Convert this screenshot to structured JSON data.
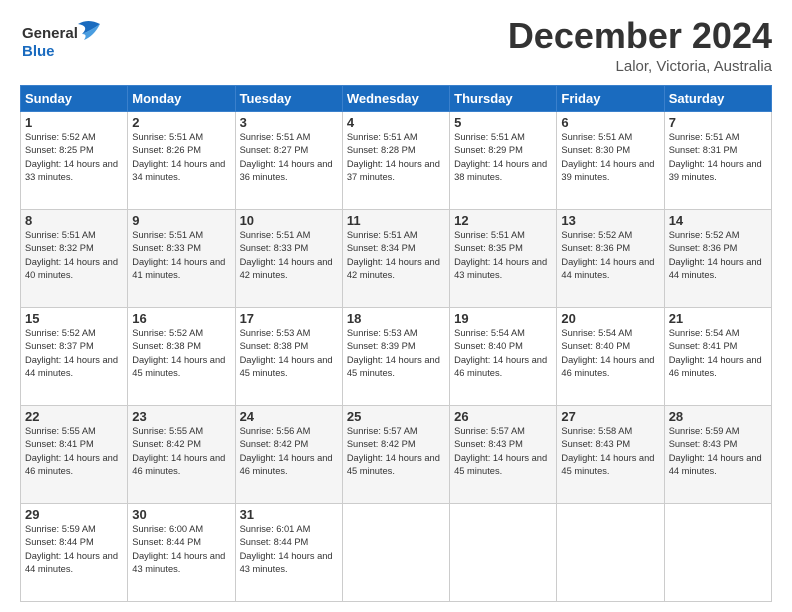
{
  "header": {
    "logo_line1": "General",
    "logo_line2": "Blue",
    "month": "December 2024",
    "location": "Lalor, Victoria, Australia"
  },
  "weekdays": [
    "Sunday",
    "Monday",
    "Tuesday",
    "Wednesday",
    "Thursday",
    "Friday",
    "Saturday"
  ],
  "weeks": [
    [
      {
        "day": "1",
        "sunrise": "5:52 AM",
        "sunset": "8:25 PM",
        "daylight": "14 hours and 33 minutes."
      },
      {
        "day": "2",
        "sunrise": "5:51 AM",
        "sunset": "8:26 PM",
        "daylight": "14 hours and 34 minutes."
      },
      {
        "day": "3",
        "sunrise": "5:51 AM",
        "sunset": "8:27 PM",
        "daylight": "14 hours and 36 minutes."
      },
      {
        "day": "4",
        "sunrise": "5:51 AM",
        "sunset": "8:28 PM",
        "daylight": "14 hours and 37 minutes."
      },
      {
        "day": "5",
        "sunrise": "5:51 AM",
        "sunset": "8:29 PM",
        "daylight": "14 hours and 38 minutes."
      },
      {
        "day": "6",
        "sunrise": "5:51 AM",
        "sunset": "8:30 PM",
        "daylight": "14 hours and 39 minutes."
      },
      {
        "day": "7",
        "sunrise": "5:51 AM",
        "sunset": "8:31 PM",
        "daylight": "14 hours and 39 minutes."
      }
    ],
    [
      {
        "day": "8",
        "sunrise": "5:51 AM",
        "sunset": "8:32 PM",
        "daylight": "14 hours and 40 minutes."
      },
      {
        "day": "9",
        "sunrise": "5:51 AM",
        "sunset": "8:33 PM",
        "daylight": "14 hours and 41 minutes."
      },
      {
        "day": "10",
        "sunrise": "5:51 AM",
        "sunset": "8:33 PM",
        "daylight": "14 hours and 42 minutes."
      },
      {
        "day": "11",
        "sunrise": "5:51 AM",
        "sunset": "8:34 PM",
        "daylight": "14 hours and 42 minutes."
      },
      {
        "day": "12",
        "sunrise": "5:51 AM",
        "sunset": "8:35 PM",
        "daylight": "14 hours and 43 minutes."
      },
      {
        "day": "13",
        "sunrise": "5:52 AM",
        "sunset": "8:36 PM",
        "daylight": "14 hours and 44 minutes."
      },
      {
        "day": "14",
        "sunrise": "5:52 AM",
        "sunset": "8:36 PM",
        "daylight": "14 hours and 44 minutes."
      }
    ],
    [
      {
        "day": "15",
        "sunrise": "5:52 AM",
        "sunset": "8:37 PM",
        "daylight": "14 hours and 44 minutes."
      },
      {
        "day": "16",
        "sunrise": "5:52 AM",
        "sunset": "8:38 PM",
        "daylight": "14 hours and 45 minutes."
      },
      {
        "day": "17",
        "sunrise": "5:53 AM",
        "sunset": "8:38 PM",
        "daylight": "14 hours and 45 minutes."
      },
      {
        "day": "18",
        "sunrise": "5:53 AM",
        "sunset": "8:39 PM",
        "daylight": "14 hours and 45 minutes."
      },
      {
        "day": "19",
        "sunrise": "5:54 AM",
        "sunset": "8:40 PM",
        "daylight": "14 hours and 46 minutes."
      },
      {
        "day": "20",
        "sunrise": "5:54 AM",
        "sunset": "8:40 PM",
        "daylight": "14 hours and 46 minutes."
      },
      {
        "day": "21",
        "sunrise": "5:54 AM",
        "sunset": "8:41 PM",
        "daylight": "14 hours and 46 minutes."
      }
    ],
    [
      {
        "day": "22",
        "sunrise": "5:55 AM",
        "sunset": "8:41 PM",
        "daylight": "14 hours and 46 minutes."
      },
      {
        "day": "23",
        "sunrise": "5:55 AM",
        "sunset": "8:42 PM",
        "daylight": "14 hours and 46 minutes."
      },
      {
        "day": "24",
        "sunrise": "5:56 AM",
        "sunset": "8:42 PM",
        "daylight": "14 hours and 46 minutes."
      },
      {
        "day": "25",
        "sunrise": "5:57 AM",
        "sunset": "8:42 PM",
        "daylight": "14 hours and 45 minutes."
      },
      {
        "day": "26",
        "sunrise": "5:57 AM",
        "sunset": "8:43 PM",
        "daylight": "14 hours and 45 minutes."
      },
      {
        "day": "27",
        "sunrise": "5:58 AM",
        "sunset": "8:43 PM",
        "daylight": "14 hours and 45 minutes."
      },
      {
        "day": "28",
        "sunrise": "5:59 AM",
        "sunset": "8:43 PM",
        "daylight": "14 hours and 44 minutes."
      }
    ],
    [
      {
        "day": "29",
        "sunrise": "5:59 AM",
        "sunset": "8:44 PM",
        "daylight": "14 hours and 44 minutes."
      },
      {
        "day": "30",
        "sunrise": "6:00 AM",
        "sunset": "8:44 PM",
        "daylight": "14 hours and 43 minutes."
      },
      {
        "day": "31",
        "sunrise": "6:01 AM",
        "sunset": "8:44 PM",
        "daylight": "14 hours and 43 minutes."
      },
      null,
      null,
      null,
      null
    ]
  ]
}
